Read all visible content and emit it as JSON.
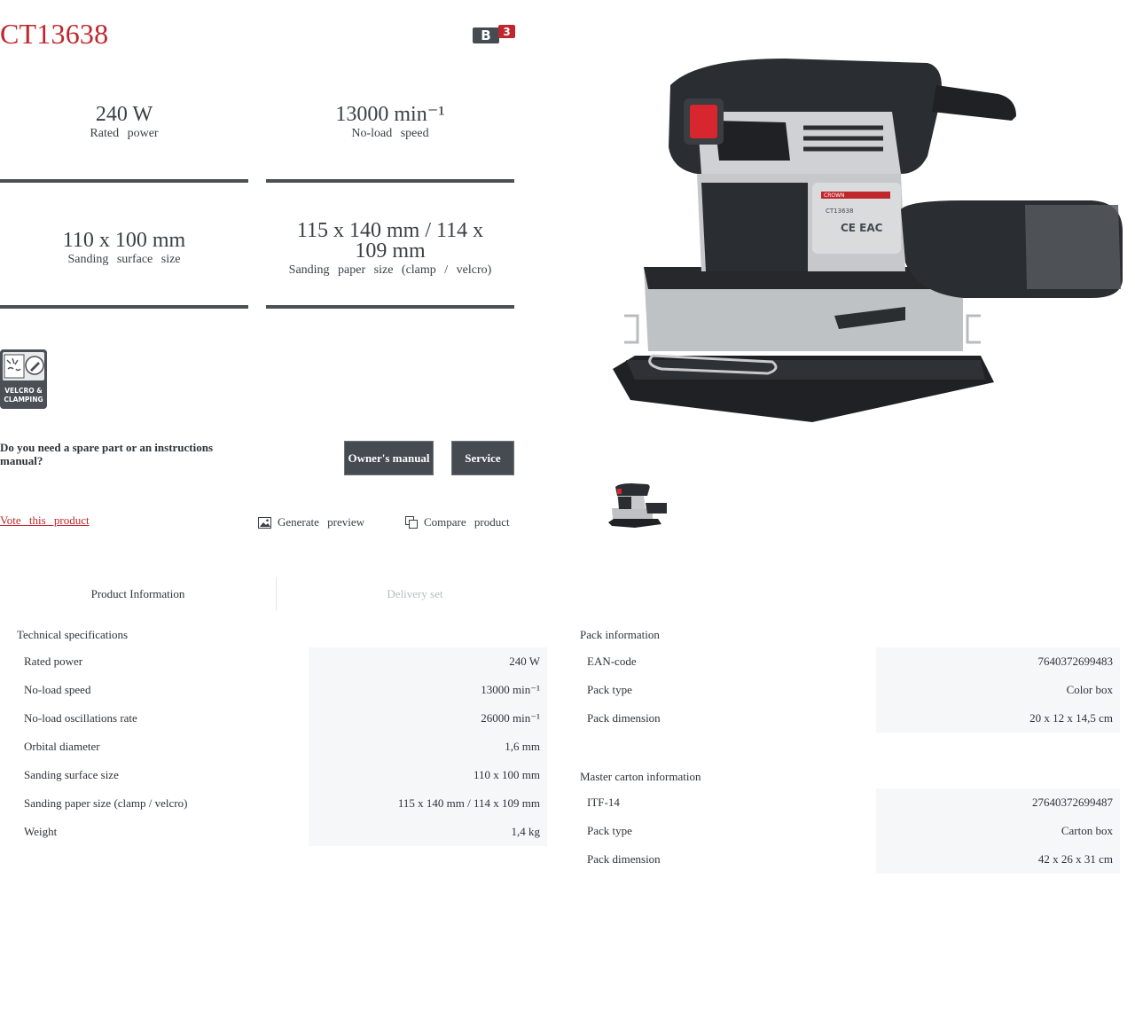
{
  "product": {
    "code": "CT13638",
    "series_badge": "B3"
  },
  "highlights": [
    {
      "value": "240 W",
      "label": "Rated power"
    },
    {
      "value": "13000 min⁻¹",
      "label": "No-load speed"
    },
    {
      "value": "110 x 100 mm",
      "label": "Sanding surface size"
    },
    {
      "value": "115 x 140 mm / 114 x 109 mm",
      "label": "Sanding paper size (clamp / velcro)"
    }
  ],
  "feature_icon": {
    "label": "VELCRO & CLAMPING",
    "icon": "velcro-clamping-icon"
  },
  "support": {
    "question": "Do you need a spare part or an instructions manual?",
    "manual_button": "Owner's manual",
    "service_button": "Service"
  },
  "actions": {
    "vote": "Vote this product",
    "preview": "Generate preview",
    "compare": "Compare product"
  },
  "tabs": [
    {
      "label": "Product Information",
      "active": true
    },
    {
      "label": "Delivery set",
      "active": false
    }
  ],
  "technical": {
    "title": "Technical specifications",
    "rows": [
      {
        "key": "Rated power",
        "value": "240 W"
      },
      {
        "key": "No-load speed",
        "value": "13000 min⁻¹"
      },
      {
        "key": "No-load oscillations rate",
        "value": "26000 min⁻¹"
      },
      {
        "key": "Orbital diameter",
        "value": "1,6 mm"
      },
      {
        "key": "Sanding surface size",
        "value": "110 x 100 mm"
      },
      {
        "key": "Sanding paper size (clamp / velcro)",
        "value": "115 x 140 mm / 114 x 109 mm"
      },
      {
        "key": "Weight",
        "value": "1,4 kg"
      }
    ]
  },
  "pack": {
    "title": "Pack information",
    "rows": [
      {
        "key": "EAN-code",
        "value": "7640372699483"
      },
      {
        "key": "Pack type",
        "value": "Color box"
      },
      {
        "key": "Pack dimension",
        "value": "20 x 12 x 14,5 cm"
      }
    ]
  },
  "master": {
    "title": "Master carton information",
    "rows": [
      {
        "key": "ITF-14",
        "value": "27640372699487"
      },
      {
        "key": "Pack type",
        "value": "Carton box"
      },
      {
        "key": "Pack dimension",
        "value": "42 x 26 x 31 cm"
      }
    ]
  },
  "colors": {
    "brand_red": "#c0272d",
    "dark": "#454b51",
    "row_bg": "#f6f7f8"
  }
}
